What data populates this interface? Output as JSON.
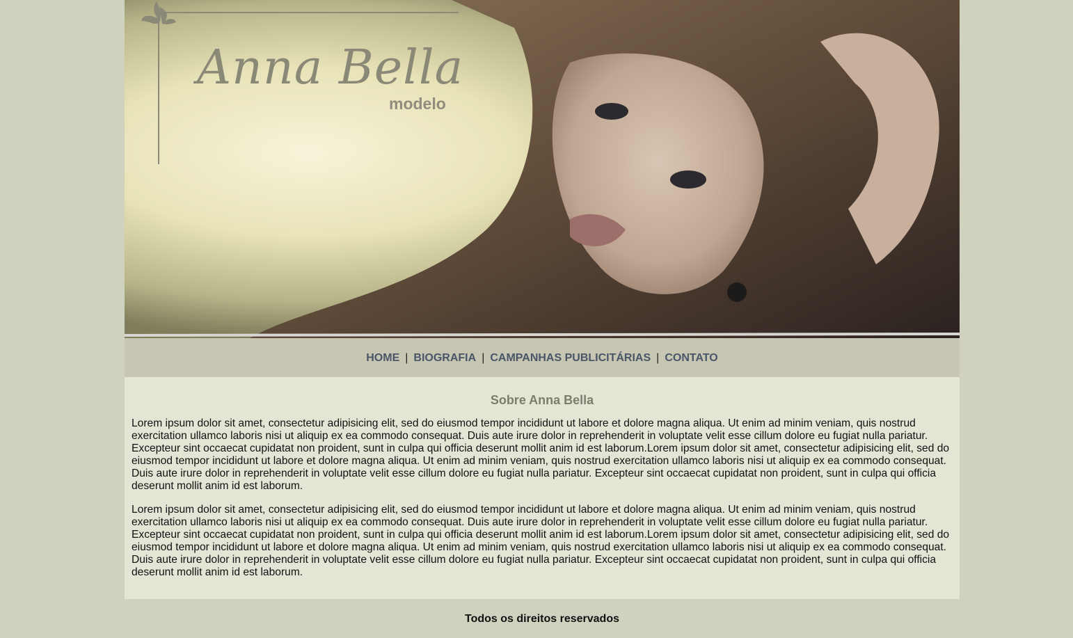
{
  "brand": {
    "name": "Anna Bella",
    "subtitle": "modelo"
  },
  "nav": {
    "items": [
      {
        "label": "HOME"
      },
      {
        "label": "BIOGRAFIA"
      },
      {
        "label": "CAMPANHAS PUBLICITÁRIAS"
      },
      {
        "label": "CONTATO"
      }
    ],
    "separator": "|"
  },
  "main": {
    "title": "Sobre Anna Bella",
    "paragraphs": [
      "Lorem ipsum dolor sit amet, consectetur adipisicing elit, sed do eiusmod tempor incididunt ut labore et dolore magna aliqua. Ut enim ad minim veniam, quis nostrud exercitation ullamco laboris nisi ut aliquip ex ea commodo consequat. Duis aute irure dolor in reprehenderit in voluptate velit esse cillum dolore eu fugiat nulla pariatur. Excepteur sint occaecat cupidatat non proident, sunt in culpa qui officia deserunt mollit anim id est laborum.Lorem ipsum dolor sit amet, consectetur adipisicing elit, sed do eiusmod tempor incididunt ut labore et dolore magna aliqua. Ut enim ad minim veniam, quis nostrud exercitation ullamco laboris nisi ut aliquip ex ea commodo consequat. Duis aute irure dolor in reprehenderit in voluptate velit esse cillum dolore eu fugiat nulla pariatur. Excepteur sint occaecat cupidatat non proident, sunt in culpa qui officia deserunt mollit anim id est laborum.",
      "Lorem ipsum dolor sit amet, consectetur adipisicing elit, sed do eiusmod tempor incididunt ut labore et dolore magna aliqua. Ut enim ad minim veniam, quis nostrud exercitation ullamco laboris nisi ut aliquip ex ea commodo consequat. Duis aute irure dolor in reprehenderit in voluptate velit esse cillum dolore eu fugiat nulla pariatur. Excepteur sint occaecat cupidatat non proident, sunt in culpa qui officia deserunt mollit anim id est laborum.Lorem ipsum dolor sit amet, consectetur adipisicing elit, sed do eiusmod tempor incididunt ut labore et dolore magna aliqua. Ut enim ad minim veniam, quis nostrud exercitation ullamco laboris nisi ut aliquip ex ea commodo consequat. Duis aute irure dolor in reprehenderit in voluptate velit esse cillum dolore eu fugiat nulla pariatur. Excepteur sint occaecat cupidatat non proident, sunt in culpa qui officia deserunt mollit anim id est laborum."
    ]
  },
  "footer": {
    "text": "Todos os direitos reservados"
  },
  "colors": {
    "page_background": "#d0d1be",
    "nav_background": "#c6c6b3",
    "nav_link": "#4a5668",
    "content_background": "#e5e5d6",
    "title": "#7d7d6e"
  }
}
